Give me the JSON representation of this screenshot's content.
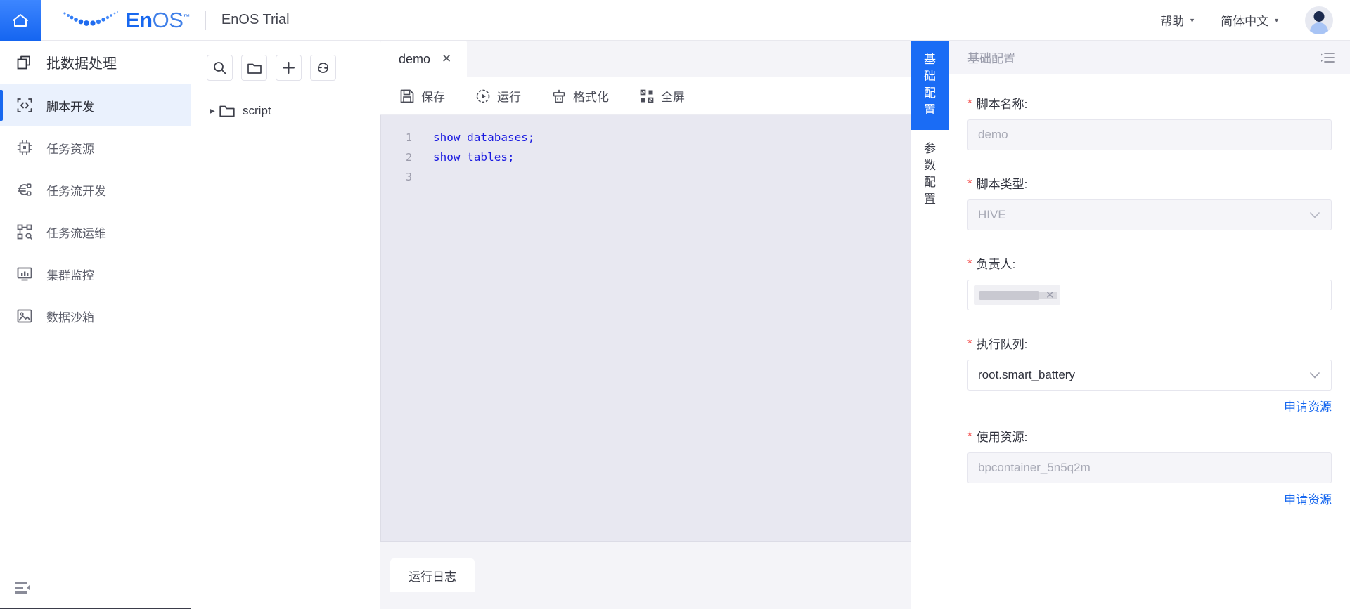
{
  "header": {
    "home_icon": "home-icon",
    "logo_text_en": "En",
    "logo_text_os": "OS",
    "logo_tm": "™",
    "product_title": "EnOS Trial",
    "menus": [
      {
        "label": "帮助",
        "icon": "chevron-down-icon"
      },
      {
        "label": "简体中文",
        "icon": "chevron-down-icon"
      }
    ],
    "avatar": "user-avatar"
  },
  "sidebar": {
    "module_title": "批数据处理",
    "module_icon": "copy-layers-icon",
    "items": [
      {
        "label": "脚本开发",
        "icon": "code-brackets-icon",
        "active": true
      },
      {
        "label": "任务资源",
        "icon": "chip-icon",
        "active": false
      },
      {
        "label": "任务流开发",
        "icon": "flow-euro-icon",
        "active": false
      },
      {
        "label": "任务流运维",
        "icon": "node-graph-icon",
        "active": false
      },
      {
        "label": "集群监控",
        "icon": "monitor-chart-icon",
        "active": false
      },
      {
        "label": "数据沙箱",
        "icon": "sandbox-image-icon",
        "active": false
      }
    ],
    "collapse_icon": "collapse-sidebar-icon"
  },
  "filetree": {
    "toolbar": [
      {
        "icon": "search-icon",
        "name": "search-button"
      },
      {
        "icon": "folder-icon",
        "name": "new-folder-button"
      },
      {
        "icon": "plus-icon",
        "name": "add-button"
      },
      {
        "icon": "refresh-icon",
        "name": "refresh-button"
      }
    ],
    "nodes": [
      {
        "label": "script",
        "icon": "folder-icon",
        "arrow": "▶"
      }
    ]
  },
  "editor": {
    "tabs": [
      {
        "label": "demo",
        "close": "✕",
        "active": true
      }
    ],
    "toolbar": [
      {
        "label": "保存",
        "icon": "save-icon"
      },
      {
        "label": "运行",
        "icon": "run-icon"
      },
      {
        "label": "格式化",
        "icon": "format-brush-icon"
      },
      {
        "label": "全屏",
        "icon": "fullscreen-icon"
      }
    ],
    "line_numbers": [
      "1",
      "2",
      "3"
    ],
    "code_lines": [
      "show databases;",
      "show tables;",
      ""
    ],
    "log_tab_label": "运行日志"
  },
  "vertical_tabs": [
    {
      "label": "基础配置",
      "chars": [
        "基",
        "础",
        "配",
        "置"
      ],
      "active": true
    },
    {
      "label": "参数配置",
      "chars": [
        "参",
        "数",
        "配",
        "置"
      ],
      "active": false
    }
  ],
  "config_panel": {
    "title": "基础配置",
    "collapse_icon": "panel-collapse-icon",
    "fields": [
      {
        "label": "脚本名称:",
        "required": "*",
        "type": "text",
        "value": "demo",
        "disabled": true
      },
      {
        "label": "脚本类型:",
        "required": "*",
        "type": "select",
        "value": "HIVE",
        "disabled": true,
        "chevron": "chevron-down-icon"
      },
      {
        "label": "负责人:",
        "required": "*",
        "type": "tags",
        "tag_remove": "✕",
        "disabled": false
      },
      {
        "label": "执行队列:",
        "required": "*",
        "type": "select",
        "value": "root.smart_battery",
        "disabled": false,
        "chevron": "chevron-down-icon",
        "link": "申请资源"
      },
      {
        "label": "使用资源:",
        "required": "*",
        "type": "text",
        "value": "bpcontainer_5n5q2m",
        "disabled": true,
        "link": "申请资源"
      }
    ]
  },
  "colors": {
    "accent": "#1868ef",
    "active_tab": "#1a6cf5",
    "required_red": "#f5514f",
    "code_blue": "#1414dd",
    "editor_bg": "#e8e8f1"
  }
}
